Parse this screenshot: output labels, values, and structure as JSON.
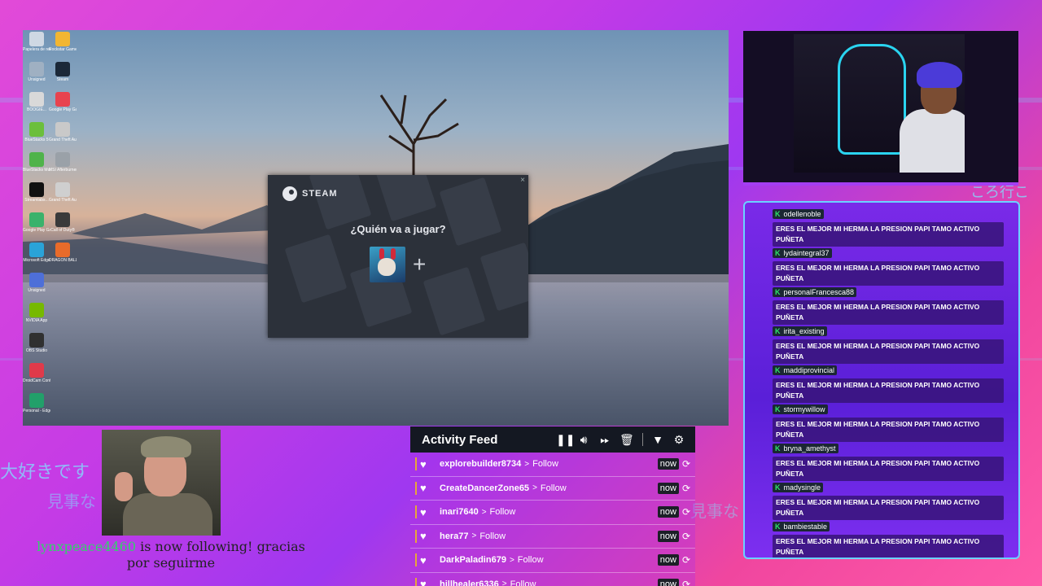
{
  "desktop": {
    "icons": [
      {
        "label": "Papelera de reciclaje",
        "icon": "recycle-bin-icon",
        "color": "#cfd8e3"
      },
      {
        "label": "Rockstar Games...",
        "icon": "rockstar-icon",
        "color": "#f2b632"
      },
      {
        "label": "Unsigned",
        "icon": "app-icon",
        "color": "#9fb0c2"
      },
      {
        "label": "Steam",
        "icon": "steam-icon",
        "color": "#1b2838"
      },
      {
        "label": "BOOGIE...",
        "icon": "file-icon",
        "color": "#d9d9d9"
      },
      {
        "label": "Google Play Games",
        "icon": "game-icon",
        "color": "#e8434f"
      },
      {
        "label": "BlueStacks 5",
        "icon": "bluestacks-icon",
        "color": "#6bbf3c"
      },
      {
        "label": "Grand Theft Auto V...",
        "icon": "gta-icon",
        "color": "#c9c9c9"
      },
      {
        "label": "BlueStacks Multi-Instance",
        "icon": "bluestacks-multi-icon",
        "color": "#4fb34a"
      },
      {
        "label": "MSI Afterburner",
        "icon": "msi-icon",
        "color": "#9aa1a8"
      },
      {
        "label": "Streamlabs...",
        "icon": "tiktok-icon",
        "color": "#111111"
      },
      {
        "label": "Grand Theft Auto IV...",
        "icon": "gta4-icon",
        "color": "#cfcfcf"
      },
      {
        "label": "Google Play Games beta",
        "icon": "play-games-icon",
        "color": "#3ab26b"
      },
      {
        "label": "Call of Duty®",
        "icon": "cod-icon",
        "color": "#3a3a3a"
      },
      {
        "label": "Microsoft Edge",
        "icon": "edge-icon",
        "color": "#2aa3d8"
      },
      {
        "label": "DRAGON BALL XENOVERSE",
        "icon": "dragonball-icon",
        "color": "#e86b2a"
      },
      {
        "label": "Unsigned",
        "icon": "app-icon",
        "color": "#4e6fd8"
      },
      {
        "label": "NVIDIA App",
        "icon": "nvidia-icon",
        "color": "#76b900"
      },
      {
        "label": "OBS Studio",
        "icon": "obs-icon",
        "color": "#303030"
      },
      {
        "label": "DroidCam Control",
        "icon": "droidcam-icon",
        "color": "#e03a4a"
      },
      {
        "label": "Personal - Edge",
        "icon": "edge-icon",
        "color": "#22a06a"
      }
    ]
  },
  "steam": {
    "brand": "STEAM",
    "question": "¿Quién va a jugar?",
    "add_symbol": "+",
    "close_symbol": "×"
  },
  "chat": {
    "messages": [
      {
        "user": "odellenoble",
        "text": "ERES EL MEJOR MI HERMA LA PRESION PAPI TAMO ACTIVO PUÑETA"
      },
      {
        "user": "lydaintegral37",
        "text": "ERES EL MEJOR MI HERMA LA PRESION PAPI TAMO ACTIVO PUÑETA"
      },
      {
        "user": "personalFrancesca88",
        "text": "ERES EL MEJOR MI HERMA LA PRESION PAPI TAMO ACTIVO PUÑETA"
      },
      {
        "user": "irita_existing",
        "text": "ERES EL MEJOR MI HERMA LA PRESION PAPI TAMO ACTIVO PUÑETA"
      },
      {
        "user": "maddiprovincial",
        "text": "ERES EL MEJOR MI HERMA LA PRESION PAPI TAMO ACTIVO PUÑETA"
      },
      {
        "user": "stormywillow",
        "text": "ERES EL MEJOR MI HERMA LA PRESION PAPI TAMO ACTIVO PUÑETA"
      },
      {
        "user": "bryna_amethyst",
        "text": "ERES EL MEJOR MI HERMA LA PRESION PAPI TAMO ACTIVO PUÑETA"
      },
      {
        "user": "madysingle",
        "text": "ERES EL MEJOR MI HERMA LA PRESION PAPI TAMO ACTIVO PUÑETA"
      },
      {
        "user": "bambiestable",
        "text": "ERES EL MEJOR MI HERMA LA PRESION PAPI TAMO ACTIVO PUÑETA"
      }
    ],
    "badge_letter": "K"
  },
  "overlay": {
    "jp_left_1": "大好きです",
    "jp_left_2": "見事な",
    "jp_right_1": "見事な",
    "jp_top_right": "ころ行こ"
  },
  "follow_alert": {
    "username": "lynxpeace4460",
    "message": " is now following! gracias por seguirme"
  },
  "activity_feed": {
    "title": "Activity Feed",
    "controls": [
      "pause-icon",
      "volume-icon",
      "skip-icon",
      "trash-icon",
      "filter-icon",
      "gear-icon"
    ],
    "events": [
      {
        "user": "explorebuilder8734",
        "event": "Follow",
        "time": "now"
      },
      {
        "user": "CreateDancerZone65",
        "event": "Follow",
        "time": "now"
      },
      {
        "user": "inari7640",
        "event": "Follow",
        "time": "now"
      },
      {
        "user": "hera77",
        "event": "Follow",
        "time": "now"
      },
      {
        "user": "DarkPaladin679",
        "event": "Follow",
        "time": "now"
      },
      {
        "user": "hillhealer6336",
        "event": "Follow",
        "time": "now"
      }
    ]
  },
  "colors": {
    "accent_cyan": "#6ad2ff",
    "chat_purple": "#5a1fd8",
    "follow_green": "#33d16b",
    "feed_header": "#141822"
  }
}
